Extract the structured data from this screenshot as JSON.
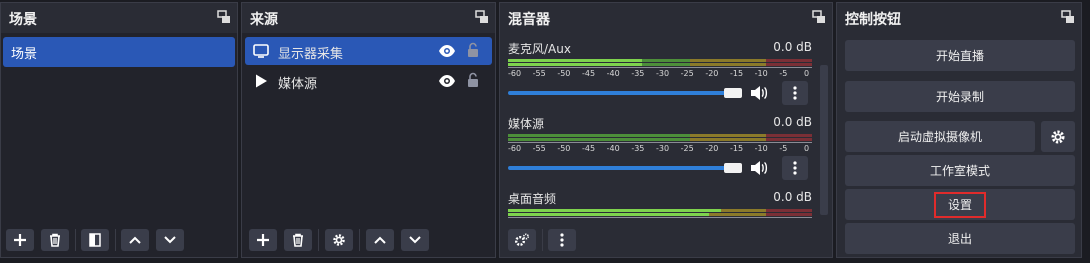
{
  "scenes": {
    "title": "场景",
    "items": [
      {
        "label": "场景"
      }
    ]
  },
  "sources": {
    "title": "来源",
    "items": [
      {
        "label": "显示器采集",
        "icon": "monitor-icon"
      },
      {
        "label": "媒体源",
        "icon": "play-icon"
      }
    ]
  },
  "mixer": {
    "title": "混音器",
    "ticks": [
      "-60",
      "-55",
      "-50",
      "-45",
      "-40",
      "-35",
      "-30",
      "-25",
      "-20",
      "-15",
      "-10",
      "-5",
      "0"
    ],
    "channels": [
      {
        "name": "麦克风/Aux",
        "db": "0.0 dB"
      },
      {
        "name": "媒体源",
        "db": "0.0 dB"
      },
      {
        "name": "桌面音频",
        "db": "0.0 dB"
      }
    ]
  },
  "controls": {
    "title": "控制按钮",
    "start_stream": "开始直播",
    "start_record": "开始录制",
    "start_virtual_cam": "启动虚拟摄像机",
    "studio_mode": "工作室模式",
    "settings": "设置",
    "exit": "退出"
  },
  "colors": {
    "selected": "#2a58b6",
    "highlight_border": "#e02b2b",
    "slider": "#2f7fd9"
  }
}
